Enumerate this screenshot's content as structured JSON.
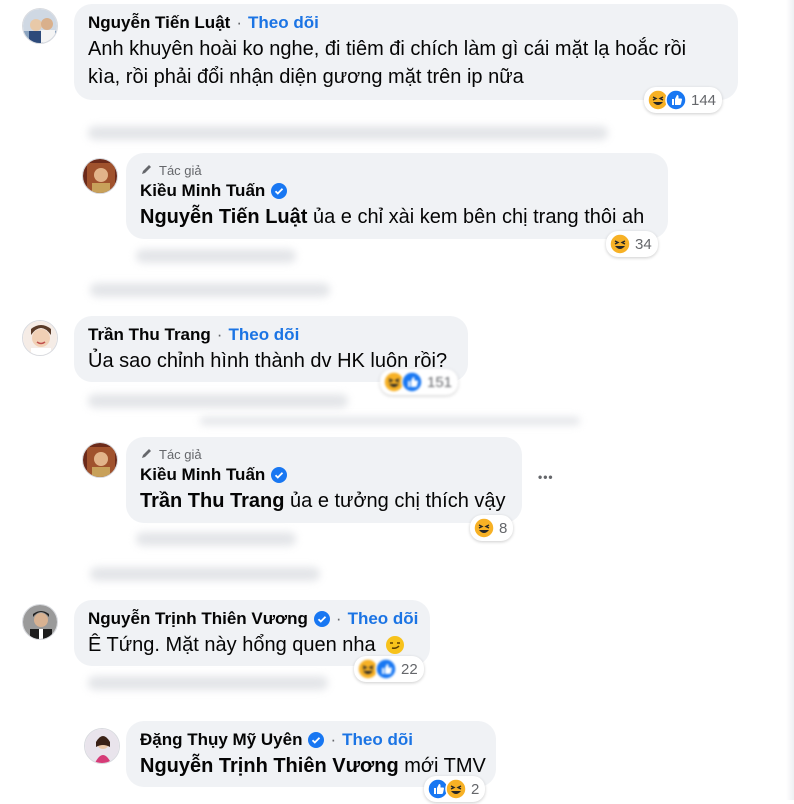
{
  "comments": [
    {
      "name": "Nguyễn Tiến Luật",
      "follow": "Theo dõi",
      "lines": [
        "Anh khuyên hoài ko nghe, đi tiêm đi chích làm gì cái mặt lạ hoắc rồi",
        "kìa, rồi phải đổi nhận diện gương mặt trên ip nữa"
      ],
      "reaction_count": "144"
    },
    {
      "author_tag": "Tác giả",
      "name": "Kiều Minh Tuấn",
      "mention": "Nguyễn Tiến Luật",
      "text": " ủa e chỉ xài kem bên chị trang thôi ah",
      "reaction_count": "34"
    },
    {
      "name": "Trần Thu Trang",
      "follow": "Theo dõi",
      "text": "Ủa sao chỉnh hình thành dv HK luôn rồi?",
      "reaction_count": "151"
    },
    {
      "author_tag": "Tác giả",
      "name": "Kiều Minh Tuấn",
      "mention": "Trần Thu Trang",
      "text": " ủa e tưởng chị thích vậy",
      "reaction_count": "8",
      "more": "•••"
    },
    {
      "name": "Nguyễn Trịnh Thiên Vương",
      "follow": "Theo dõi",
      "text": "Ê Tứng. Mặt này hổng quen nha ",
      "reaction_count": "22"
    },
    {
      "name": "Đặng Thụy Mỹ Uyên",
      "follow": "Theo dõi",
      "mention": "Nguyễn Trịnh Thiên Vương",
      "text": " mới TMV",
      "reaction_count": "2"
    }
  ],
  "colors": {
    "bubble": "#f0f2f5",
    "follow": "#1b74e4",
    "like": "#1877f2",
    "haha": "#f7b125",
    "muted": "#65676b"
  },
  "icons": [
    "verified-badge-icon",
    "pen-icon",
    "like-icon",
    "haha-icon",
    "smirk-emoji-icon"
  ]
}
